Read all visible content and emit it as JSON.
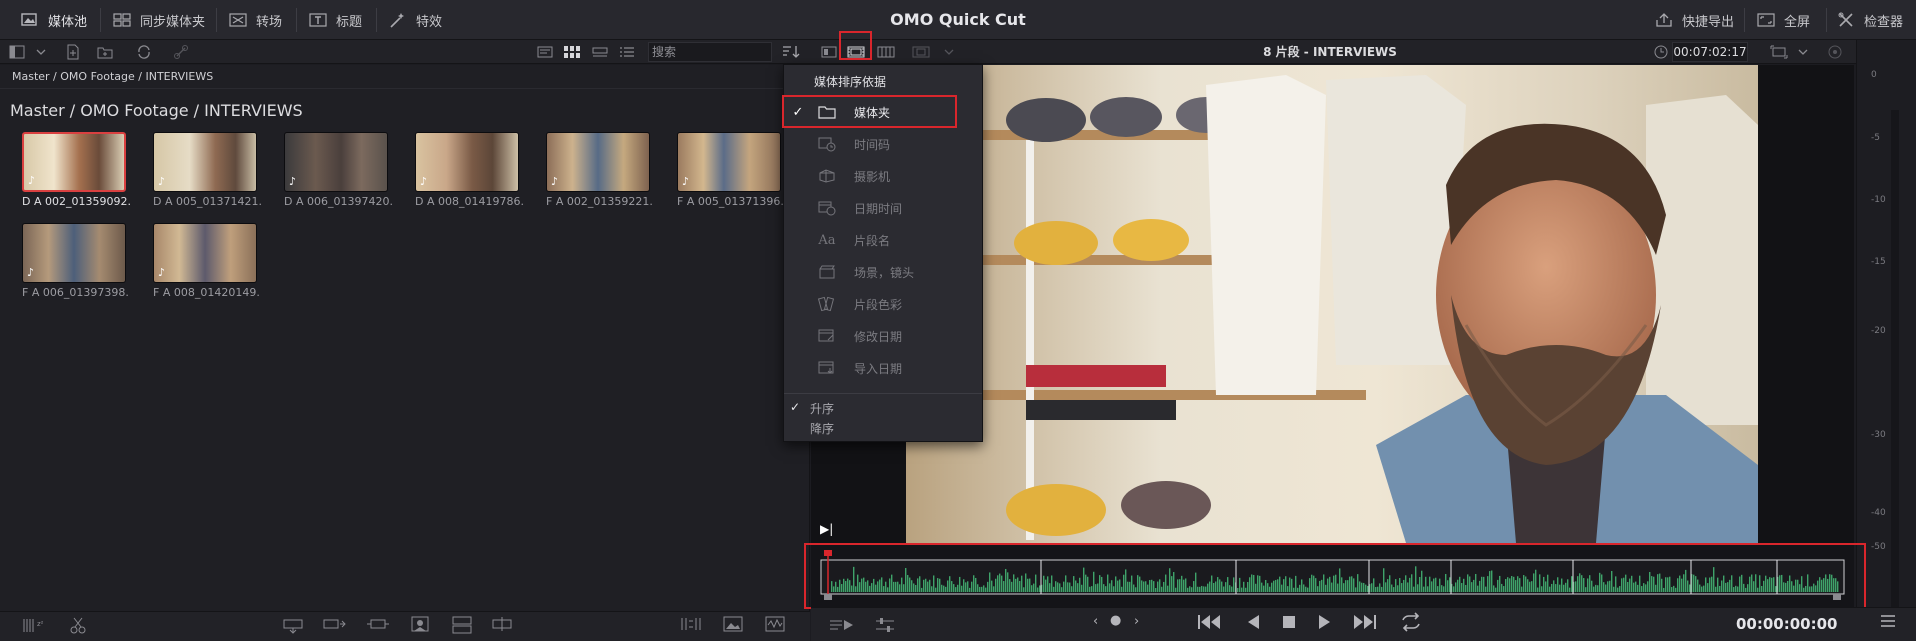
{
  "app": {
    "title": "OMO Quick Cut"
  },
  "topbar": {
    "media_pool": "媒体池",
    "sync_bin": "同步媒体夹",
    "transitions": "转场",
    "titles": "标题",
    "effects": "特效",
    "quick_export": "快捷导出",
    "fullscreen": "全屏",
    "inspector": "检查器"
  },
  "toolbar2": {
    "search_placeholder": "搜索",
    "viewer_title": "8 片段 - INTERVIEWS",
    "timecode": "00:07:02:17"
  },
  "pool": {
    "breadcrumb": "Master / OMO Footage / INTERVIEWS",
    "path_title": "Master / OMO Footage / INTERVIEWS",
    "clips": [
      {
        "name": "D A 002_01359092...",
        "selected": true
      },
      {
        "name": "D A 005_01371421..."
      },
      {
        "name": "D A 006_01397420..."
      },
      {
        "name": "D A 008_01419786..."
      },
      {
        "name": "F A 002_01359221..."
      },
      {
        "name": "F A 005_01371396..."
      },
      {
        "name": "F A 006_01397398..."
      },
      {
        "name": "F A 008_01420149..."
      }
    ]
  },
  "sort_menu": {
    "header": "媒体排序依据",
    "items": [
      {
        "label": "媒体夹",
        "icon": "folder-icon",
        "checked": true
      },
      {
        "label": "时间码",
        "icon": "timecode-icon"
      },
      {
        "label": "摄影机",
        "icon": "camera-icon"
      },
      {
        "label": "日期时间",
        "icon": "datetime-icon"
      },
      {
        "label": "片段名",
        "icon": "clip-name-icon"
      },
      {
        "label": "场景，镜头",
        "icon": "scene-shot-icon"
      },
      {
        "label": "片段色彩",
        "icon": "clip-color-icon"
      },
      {
        "label": "修改日期",
        "icon": "modified-date-icon"
      },
      {
        "label": "导入日期",
        "icon": "import-date-icon"
      }
    ],
    "ascending": "升序",
    "descending": "降序",
    "order_selected": "ascending"
  },
  "meter": {
    "ticks": [
      "0",
      "-5",
      "-10",
      "-15",
      "-20",
      "-30",
      "-40",
      "-50"
    ]
  },
  "viewer": {
    "timecode_out": "00:00:00:00"
  },
  "colors": {
    "accent_red": "#d9262c",
    "waveform_green": "#3fa36a"
  }
}
